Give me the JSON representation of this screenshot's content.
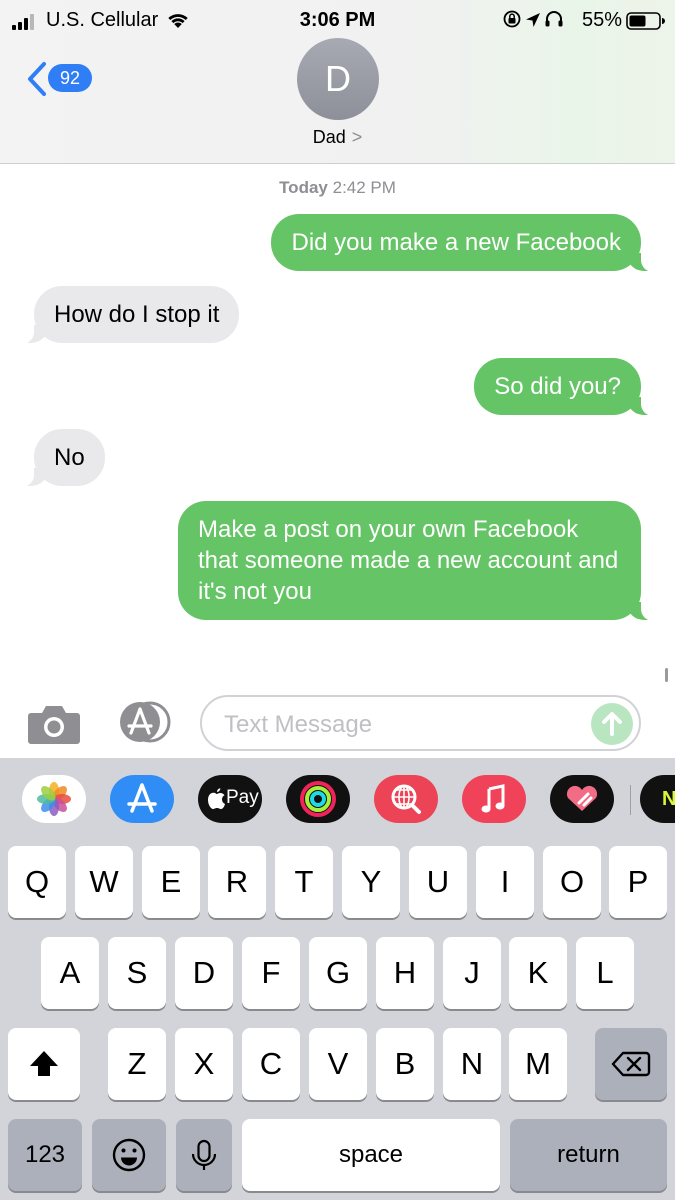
{
  "status_bar": {
    "carrier": "U.S. Cellular",
    "time": "3:06 PM",
    "battery": "55%"
  },
  "header": {
    "back_badge": "92",
    "avatar_initial": "D",
    "contact_name": "Dad",
    "contact_chevron": ">"
  },
  "conversation": {
    "timestamp_day": "Today",
    "timestamp_time": "2:42 PM",
    "messages": [
      {
        "sender": "me",
        "text": "Did you make a new Facebook"
      },
      {
        "sender": "them",
        "text": "How do I stop it"
      },
      {
        "sender": "me",
        "text": "So did you?"
      },
      {
        "sender": "them",
        "text": "No"
      },
      {
        "sender": "me",
        "text": "Make a post on your own Facebook that someone made a new account and it's not you"
      }
    ]
  },
  "input_bar": {
    "placeholder": "Text Message",
    "value": ""
  },
  "app_drawer": {
    "apps": [
      "photos-icon",
      "app-store-icon",
      "apple-pay-icon",
      "activity-icon",
      "web-search-icon",
      "music-icon",
      "digital-touch-icon",
      "nike-icon"
    ],
    "apple_pay_label": "Pay",
    "nike_label": "N"
  },
  "keyboard": {
    "row1": [
      "Q",
      "W",
      "E",
      "R",
      "T",
      "Y",
      "U",
      "I",
      "O",
      "P"
    ],
    "row2": [
      "A",
      "S",
      "D",
      "F",
      "G",
      "H",
      "J",
      "K",
      "L"
    ],
    "row3": [
      "Z",
      "X",
      "C",
      "V",
      "B",
      "N",
      "M"
    ],
    "numbers_key": "123",
    "space_key": "space",
    "return_key": "return"
  },
  "colors": {
    "sent_bubble": "#65c466",
    "received_bubble": "#e9e9eb",
    "accent": "#2f7ef6",
    "keyboard_bg": "#d2d4d9"
  }
}
